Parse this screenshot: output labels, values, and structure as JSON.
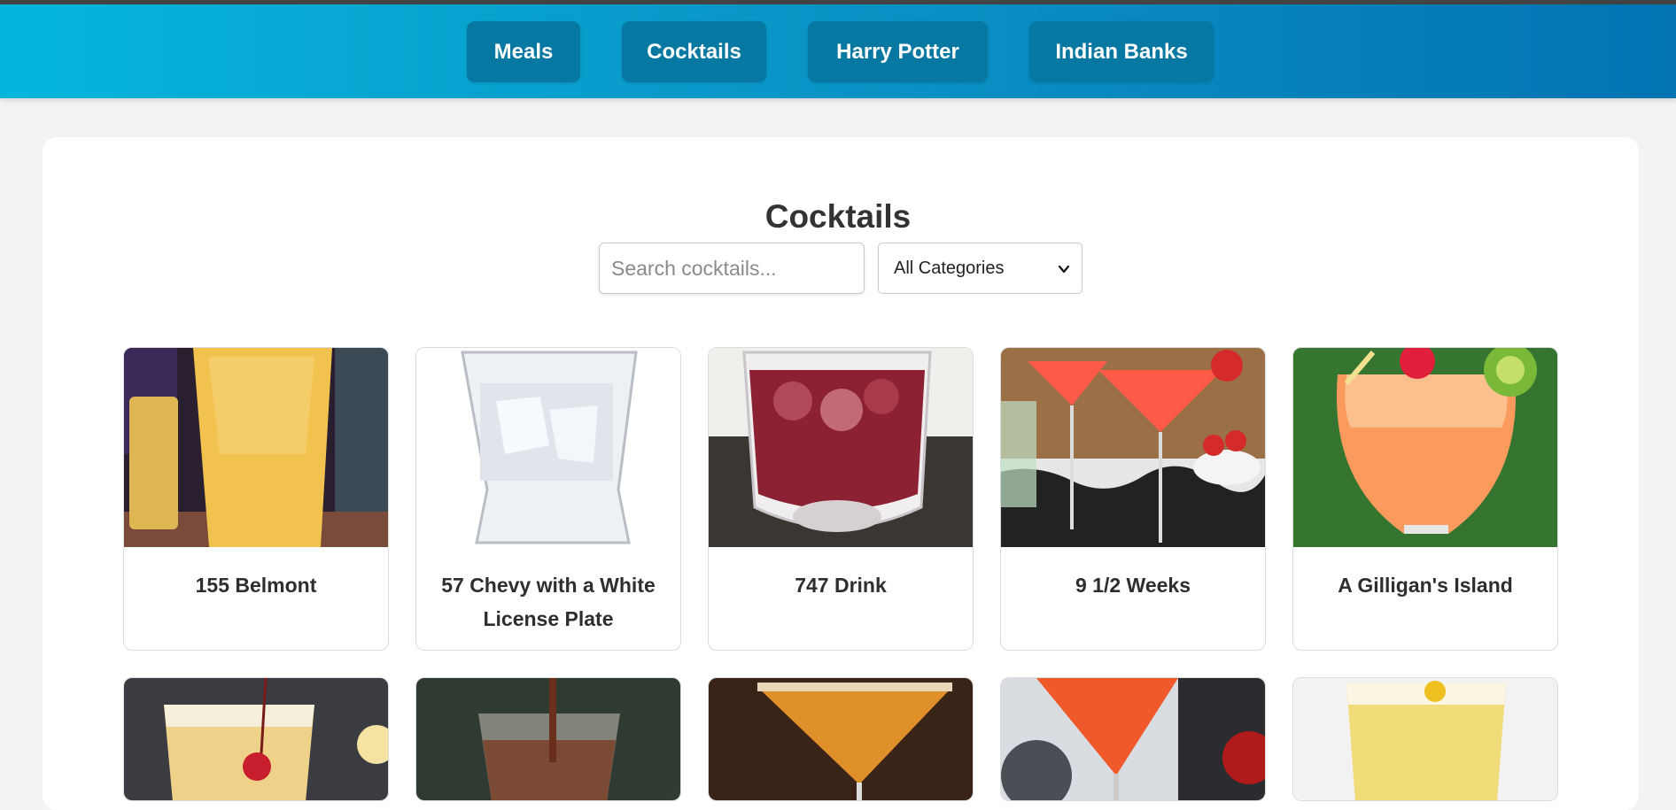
{
  "nav": {
    "items": [
      {
        "label": "Meals"
      },
      {
        "label": "Cocktails"
      },
      {
        "label": "Harry Potter"
      },
      {
        "label": "Indian Banks"
      }
    ]
  },
  "page": {
    "title": "Cocktails"
  },
  "filters": {
    "search_placeholder": "Search cocktails...",
    "search_value": "",
    "category_selected": "All Categories"
  },
  "cocktails": [
    {
      "name": "155 Belmont",
      "image": "tall-glass-orange-drink"
    },
    {
      "name": "57 Chevy with a White License Plate",
      "image": "clear-rocks-glass-ice"
    },
    {
      "name": "747 Drink",
      "image": "red-drink-rocks-glass"
    },
    {
      "name": "9 1/2 Weeks",
      "image": "pink-martini-strawberries"
    },
    {
      "name": "A Gilligan's Island",
      "image": "orange-drink-cherry-kiwi"
    },
    {
      "name": "",
      "image": "drink-with-cherry"
    },
    {
      "name": "",
      "image": "brown-drink-pouring"
    },
    {
      "name": "",
      "image": "orange-martini-sugar-rim"
    },
    {
      "name": "",
      "image": "red-martini"
    },
    {
      "name": "",
      "image": "yellow-fizzy-drink"
    }
  ],
  "colors": {
    "nav_start": "#05b6dc",
    "nav_end": "#0373b2",
    "nav_button": "#0778a2",
    "background": "#f3f3f3",
    "panel": "#ffffff"
  }
}
